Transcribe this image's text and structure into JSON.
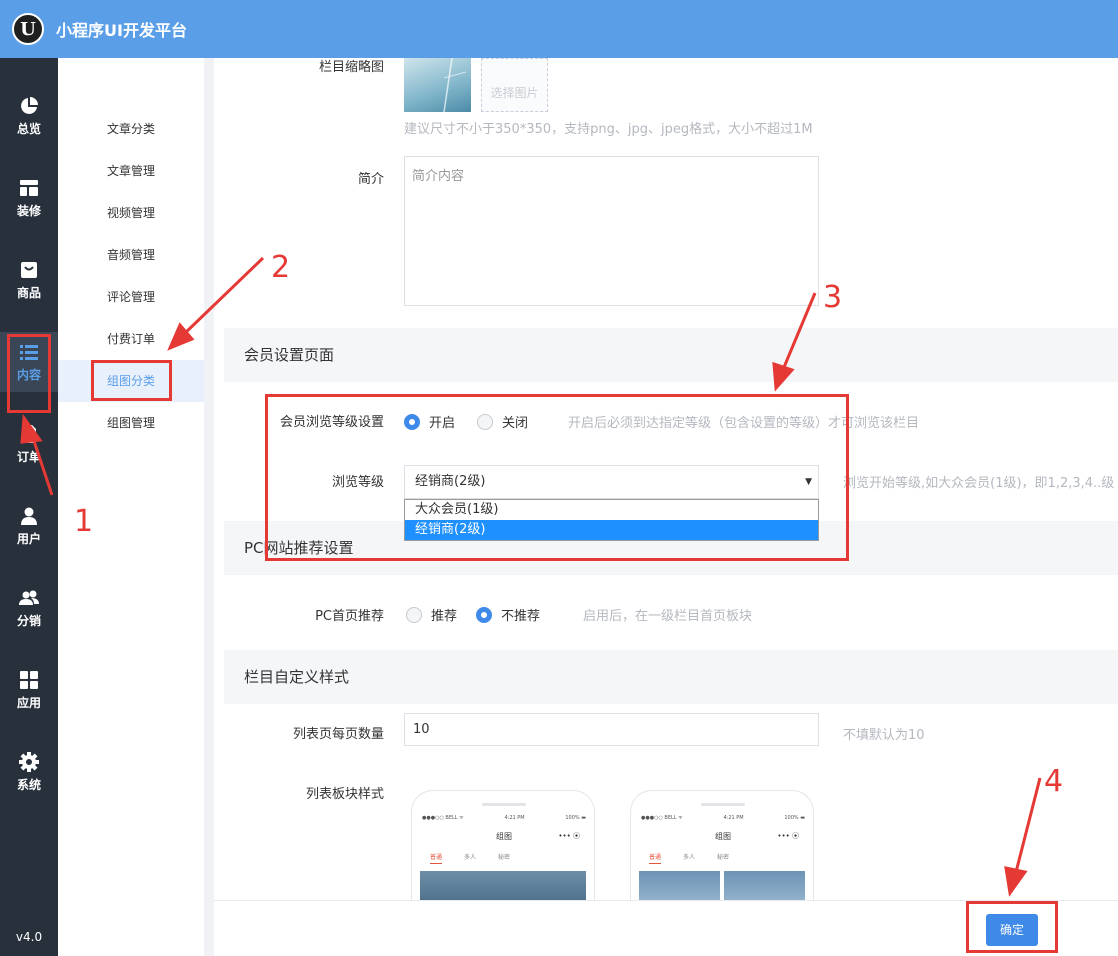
{
  "app": {
    "logo_letter": "U",
    "title": "小程序UI开发平台",
    "version": "v4.0"
  },
  "sidebar": {
    "items": [
      {
        "label": "总览",
        "icon": "pie-chart-icon"
      },
      {
        "label": "装修",
        "icon": "layout-icon"
      },
      {
        "label": "商品",
        "icon": "shopping-bag-icon"
      },
      {
        "label": "内容",
        "icon": "list-icon",
        "active": true
      },
      {
        "label": "订单",
        "icon": "document-icon"
      },
      {
        "label": "用户",
        "icon": "user-icon"
      },
      {
        "label": "分销",
        "icon": "users-icon"
      },
      {
        "label": "应用",
        "icon": "grid-icon"
      },
      {
        "label": "系统",
        "icon": "gear-icon"
      }
    ]
  },
  "subnav": {
    "items": [
      "文章分类",
      "文章管理",
      "视频管理",
      "音频管理",
      "评论管理",
      "付费订单",
      "组图分类",
      "组图管理"
    ],
    "active": "组图分类"
  },
  "form": {
    "thumb_label": "栏目缩略图",
    "upload_label": "选择图片",
    "thumb_hint": "建议尺寸不小于350*350，支持png、jpg、jpeg格式，大小不超过1M",
    "intro_label": "简介",
    "intro_placeholder": "简介内容",
    "member_section": "会员设置页面",
    "member_browse_label": "会员浏览等级设置",
    "member_on": "开启",
    "member_off": "关闭",
    "member_hint": "开启后必须到达指定等级（包含设置的等级）才可浏览该栏目",
    "browse_level_label": "浏览等级",
    "browse_level_value": "经销商(2级)",
    "browse_level_hint": "浏览开始等级,如大众会员(1级)，即1,2,3,4..级",
    "browse_level_options": [
      "大众会员(1级)",
      "经销商(2级)"
    ],
    "pc_section": "PC网站推荐设置",
    "pc_home_label": "PC首页推荐",
    "pc_recommend": "推荐",
    "pc_no_recommend": "不推荐",
    "pc_hint": "启用后，在一级栏目首页板块",
    "custom_section": "栏目自定义样式",
    "per_page_label": "列表页每页数量",
    "per_page_value": "10",
    "per_page_hint": "不填默认为10",
    "list_style_label": "列表板块样式",
    "phone": {
      "carrier": "●●●○○ BELL ᯤ",
      "time": "4:21 PM",
      "battery": "100% ▬",
      "title": "组图",
      "buttons": "••• ⦿",
      "tabs": [
        "普通",
        "多人",
        "秘密"
      ]
    },
    "submit": "确定"
  },
  "annotations": [
    "1",
    "2",
    "3",
    "4"
  ],
  "colors": {
    "topbar": "#5b9ee8",
    "sidebar": "#27303b",
    "accent": "#3f8ae8",
    "annotation": "#e53935"
  }
}
